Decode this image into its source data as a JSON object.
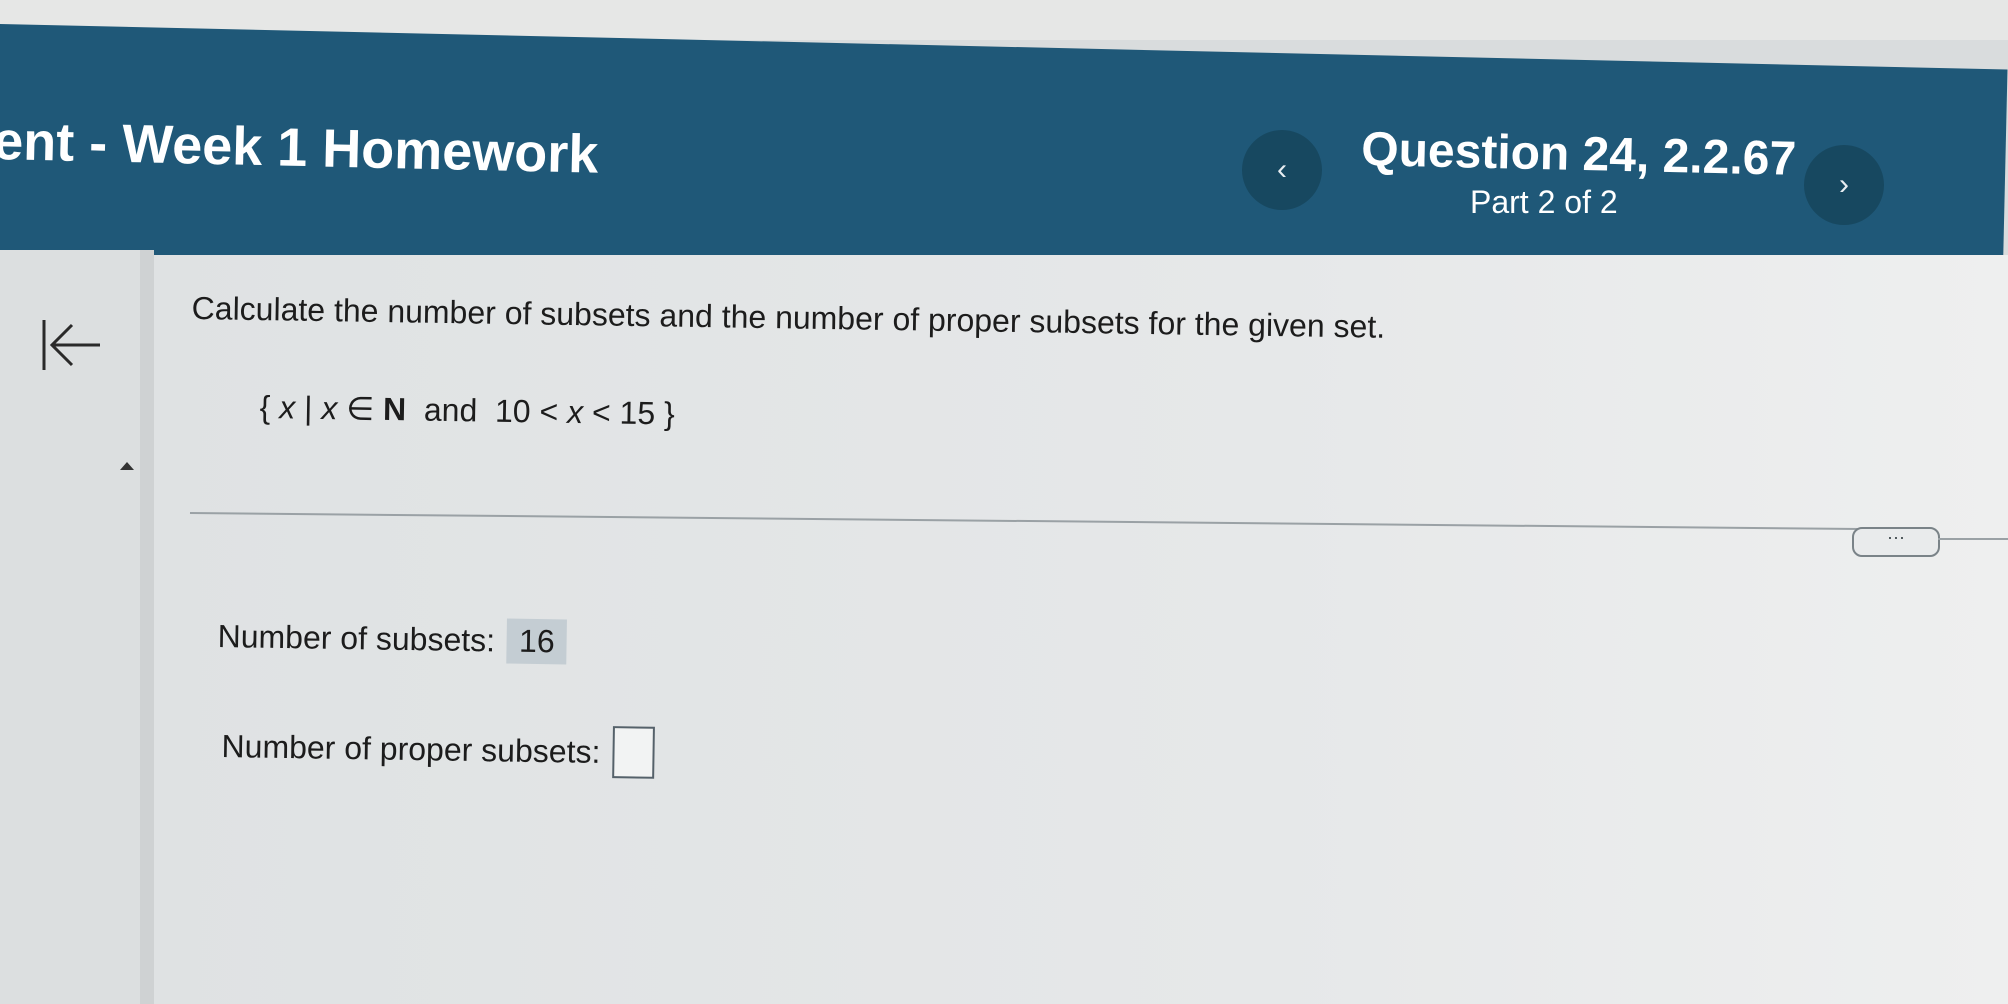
{
  "header": {
    "title": "ent - Week 1 Homework",
    "question": "Question 24, 2.2.67",
    "part": "Part 2 of 2",
    "prev_icon": "chevron-left-icon",
    "next_icon": "chevron-right-icon"
  },
  "problem": {
    "instruction": "Calculate the number of subsets and the number of proper subsets for the given set.",
    "set": {
      "open": "{",
      "var1": "x",
      "bar": "|",
      "var2": "x",
      "member": "∈",
      "naturals": "N",
      "and": "and",
      "lower": "10",
      "lt1": "<",
      "var3": "x",
      "lt2": "<",
      "upper": "15",
      "close": "}"
    }
  },
  "more_button": "···",
  "answers": {
    "subsets_label": "Number of subsets:",
    "subsets_value": "16",
    "proper_label": "Number of proper subsets:",
    "proper_value": ""
  },
  "colors": {
    "header_bg": "#1f5878",
    "nav_button_bg": "#174860",
    "answer_highlight": "#c4cdd3"
  }
}
